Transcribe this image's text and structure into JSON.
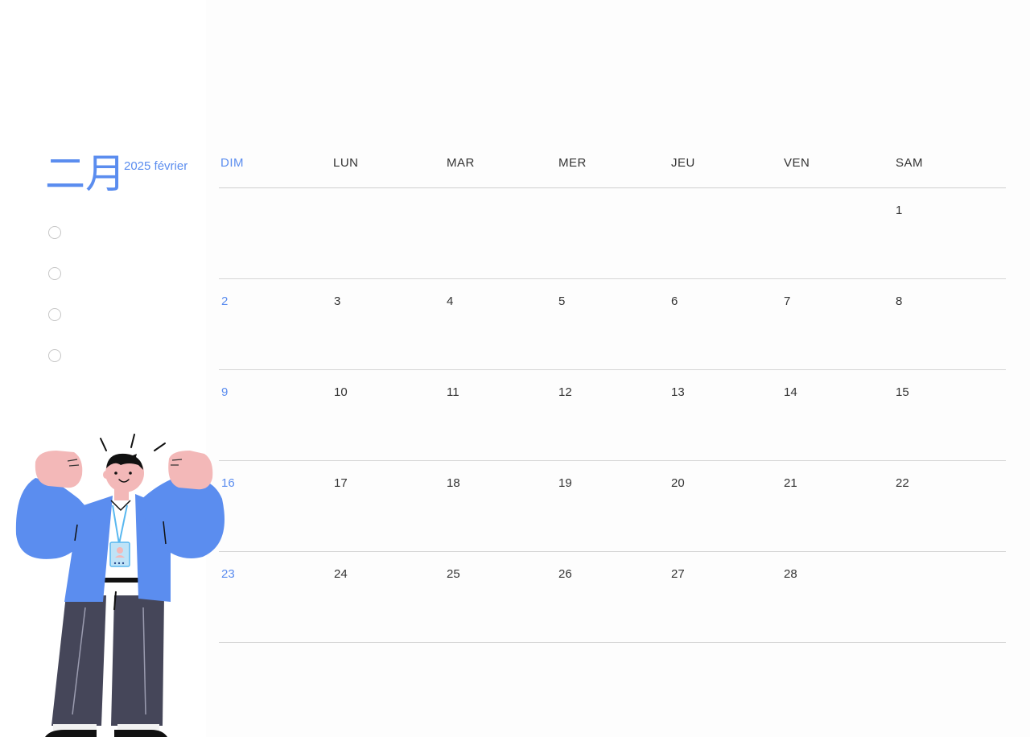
{
  "header": {
    "month_title": "二月",
    "month_subtitle": "2025 février"
  },
  "checklist": {
    "items": [
      "",
      "",
      "",
      ""
    ]
  },
  "calendar": {
    "weekdays": [
      "DIM",
      "LUN",
      "MAR",
      "MER",
      "JEU",
      "VEN",
      "SAM"
    ],
    "weeks": [
      [
        "",
        "",
        "",
        "",
        "",
        "",
        "1"
      ],
      [
        "2",
        "3",
        "4",
        "5",
        "6",
        "7",
        "8"
      ],
      [
        "9",
        "10",
        "11",
        "12",
        "13",
        "14",
        "15"
      ],
      [
        "16",
        "17",
        "18",
        "19",
        "20",
        "21",
        "22"
      ],
      [
        "23",
        "24",
        "25",
        "26",
        "27",
        "28",
        ""
      ]
    ]
  },
  "colors": {
    "accent": "#5b8def",
    "text": "#333333",
    "rule": "#d6d6d6",
    "jacket": "#5b8def",
    "pants": "#454659",
    "skin": "#f3b8b8"
  },
  "illustration": {
    "icon": "cheering-person-icon"
  }
}
